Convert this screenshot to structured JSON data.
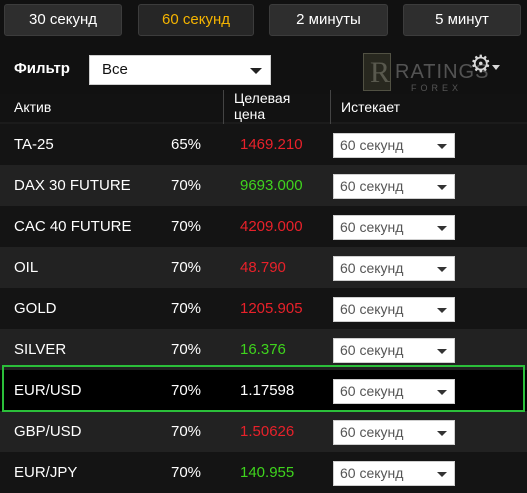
{
  "tabs": [
    {
      "label": "30 секунд",
      "active": false
    },
    {
      "label": "60 секунд",
      "active": true
    },
    {
      "label": "2 минуты",
      "active": false
    },
    {
      "label": "5 минут",
      "active": false
    }
  ],
  "filter": {
    "label": "Фильтр",
    "value": "Все"
  },
  "logo": {
    "word": "RATINGS",
    "sub": "FOREX",
    "letter": "R"
  },
  "table": {
    "headers": {
      "asset": "Актив",
      "target_line1": "Целевая",
      "target_line2": "цена",
      "expires": "Истекает"
    },
    "rows": [
      {
        "asset": "TA-25",
        "percent": "65%",
        "price": "1469.210",
        "price_color": "red",
        "expires": "60 секунд"
      },
      {
        "asset": "DAX 30 FUTURE",
        "percent": "70%",
        "price": "9693.000",
        "price_color": "green",
        "expires": "60 секунд"
      },
      {
        "asset": "CAC 40 FUTURE",
        "percent": "70%",
        "price": "4209.000",
        "price_color": "red",
        "expires": "60 секунд"
      },
      {
        "asset": "OIL",
        "percent": "70%",
        "price": "48.790",
        "price_color": "red",
        "expires": "60 секунд"
      },
      {
        "asset": "GOLD",
        "percent": "70%",
        "price": "1205.905",
        "price_color": "red",
        "expires": "60 секунд"
      },
      {
        "asset": "SILVER",
        "percent": "70%",
        "price": "16.376",
        "price_color": "green",
        "expires": "60 секунд"
      },
      {
        "asset": "EUR/USD",
        "percent": "70%",
        "price": "1.17598",
        "price_color": "white",
        "expires": "60 секунд",
        "selected": true
      },
      {
        "asset": "GBP/USD",
        "percent": "70%",
        "price": "1.50626",
        "price_color": "red",
        "expires": "60 секунд"
      },
      {
        "asset": "EUR/JPY",
        "percent": "70%",
        "price": "140.955",
        "price_color": "green",
        "expires": "60 секунд"
      }
    ]
  },
  "colors": {
    "active_tab": "#f5b400",
    "price_red": "#e8212a",
    "price_green": "#3fd41d",
    "selection_border": "#2bbf3a"
  }
}
